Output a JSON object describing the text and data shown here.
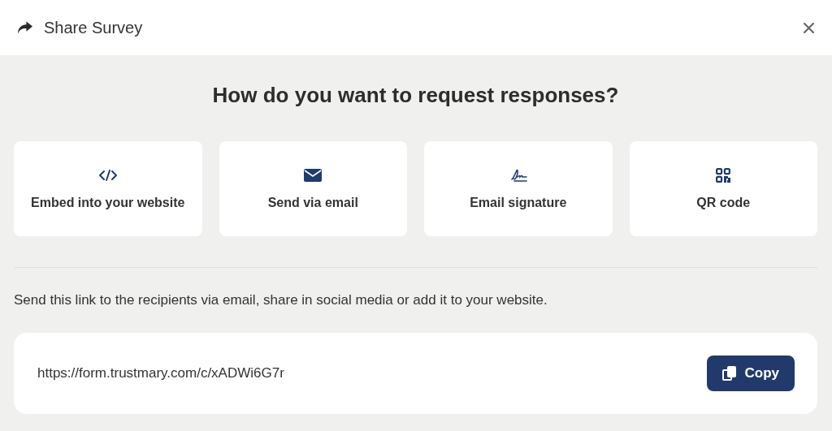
{
  "window": {
    "title": "Share Survey"
  },
  "heading": "How do you want to request responses?",
  "options": [
    {
      "kind": "embed",
      "label": "Embed into your website"
    },
    {
      "kind": "email",
      "label": "Send via email"
    },
    {
      "kind": "signature",
      "label": "Email signature"
    },
    {
      "kind": "qr",
      "label": "QR code"
    }
  ],
  "description": "Send this link to the recipients via email, share in social media or add it to your website.",
  "link": {
    "url": "https://form.trustmary.com/c/xADWi6G7r",
    "button": "Copy"
  }
}
